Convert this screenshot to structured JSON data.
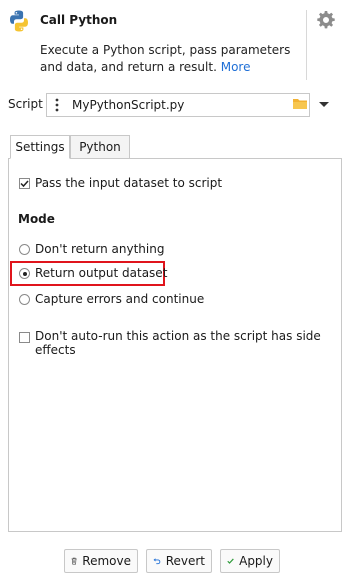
{
  "header": {
    "title": "Call Python",
    "description": "Execute a Python script, pass parameters and data, and return a result.",
    "more_link": "More"
  },
  "script": {
    "label": "Script",
    "value": "MyPythonScript.py"
  },
  "tabs": [
    {
      "label": "Settings",
      "active": true
    },
    {
      "label": "Python",
      "active": false
    }
  ],
  "settings": {
    "pass_input_label": "Pass the input dataset to script",
    "pass_input_checked": true,
    "mode_heading": "Mode",
    "mode_options": [
      {
        "label": "Don't return anything",
        "selected": false
      },
      {
        "label": "Return output dataset",
        "selected": true
      },
      {
        "label": "Capture errors and continue",
        "selected": false
      }
    ],
    "no_autorun_label": "Don't auto-run this action as the script has side effects",
    "no_autorun_checked": false
  },
  "buttons": {
    "remove": "Remove",
    "revert": "Revert",
    "apply": "Apply"
  },
  "colors": {
    "link": "#1f6fd6",
    "highlight": "#e0141c",
    "apply_check": "#2e9b3a",
    "remove_icon": "#444444",
    "revert_icon": "#1f6fd6",
    "folder": "#f2b233"
  },
  "icons": [
    "python-logo-icon",
    "gear-icon",
    "kebab-icon",
    "folder-icon",
    "chevron-down-icon",
    "trash-icon",
    "undo-icon",
    "check-icon"
  ]
}
